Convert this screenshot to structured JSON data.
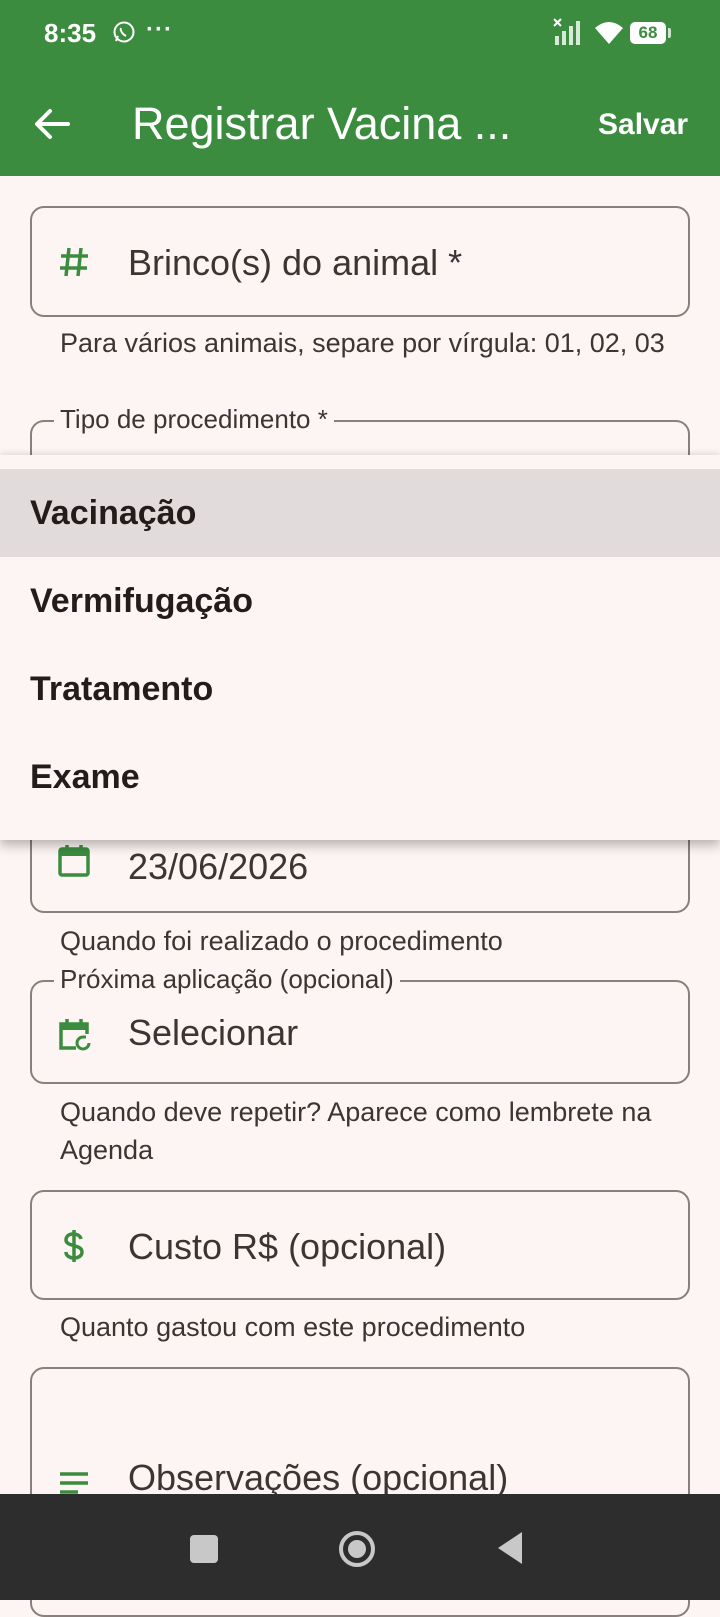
{
  "status_bar": {
    "time": "8:35",
    "dots": "···",
    "battery": "68"
  },
  "app_bar": {
    "title": "Registrar Vacina ...",
    "save_label": "Salvar"
  },
  "form": {
    "earring_field": {
      "placeholder": "Brinco(s) do animal *",
      "icon": "hash-icon"
    },
    "earring_helper": "Para vários animais, separe por vírgula: 01, 02, 03",
    "procedure_type_label": "Tipo de procedimento *",
    "date_field": {
      "value": "23/06/2026",
      "icon": "calendar-icon"
    },
    "date_helper": "Quando foi realizado o procedimento",
    "next_application": {
      "label": "Próxima aplicação (opcional)",
      "value": "Selecionar",
      "icon": "calendar-repeat-icon"
    },
    "next_helper": "Quando deve repetir? Aparece como lembrete na Agenda",
    "cost_field": {
      "placeholder": "Custo R$ (opcional)",
      "icon": "dollar-icon"
    },
    "cost_helper": "Quanto gastou com este procedimento",
    "notes_field": {
      "placeholder": "Observações (opcional)",
      "icon": "notes-icon"
    }
  },
  "dropdown": {
    "options": [
      "Vacinação",
      "Vermifugação",
      "Tratamento",
      "Exame"
    ],
    "selected": "Vacinação"
  },
  "colors": {
    "primary": "#3b8c3f",
    "background": "#fdf5f3",
    "menu_selected": "#e1dcdb"
  }
}
